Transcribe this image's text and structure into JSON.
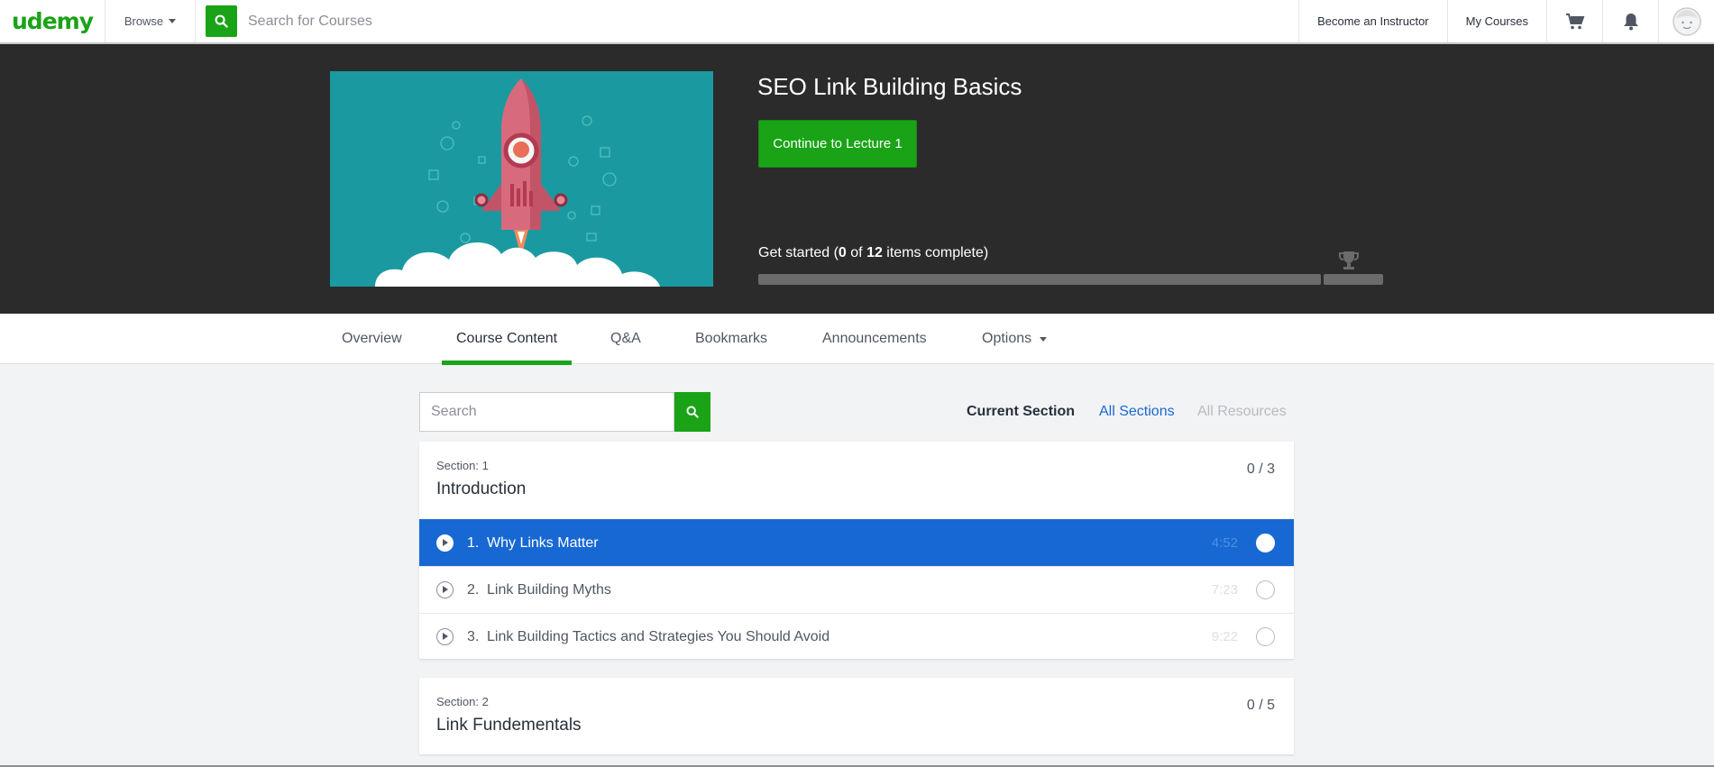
{
  "nav": {
    "logo": "udemy",
    "browse": "Browse",
    "search_placeholder": "Search for Courses",
    "become_instructor": "Become an Instructor",
    "my_courses": "My Courses"
  },
  "course": {
    "title": "SEO Link Building Basics",
    "continue_label": "Continue to Lecture 1",
    "progress_prefix": "Get started (",
    "completed": "0",
    "of_word": " of ",
    "total": "12",
    "progress_suffix": " items complete)",
    "progress_fraction": 0
  },
  "tabs": [
    {
      "label": "Overview",
      "active": false
    },
    {
      "label": "Course Content",
      "active": true
    },
    {
      "label": "Q&A",
      "active": false
    },
    {
      "label": "Bookmarks",
      "active": false
    },
    {
      "label": "Announcements",
      "active": false
    },
    {
      "label": "Options",
      "active": false
    }
  ],
  "content": {
    "search_placeholder": "Search",
    "filters": {
      "current": "Current Section",
      "all": "All Sections",
      "resources": "All Resources"
    }
  },
  "colors": {
    "brand_green": "#1aa317",
    "active_blue": "#1868d3",
    "link_blue": "#007791",
    "hero_bg": "#2b2b2b"
  },
  "sections": [
    {
      "label": "Section: 1",
      "title": "Introduction",
      "count": "0 / 3",
      "lectures": [
        {
          "num": "1.",
          "title": "Why Links Matter",
          "duration": "4:52",
          "active": true
        },
        {
          "num": "2.",
          "title": "Link Building Myths",
          "duration": "7:23",
          "active": false
        },
        {
          "num": "3.",
          "title": "Link Building Tactics and Strategies You Should Avoid",
          "duration": "9:22",
          "active": false
        }
      ]
    },
    {
      "label": "Section: 2",
      "title": "Link Fundementals",
      "count": "0 / 5"
    }
  ]
}
